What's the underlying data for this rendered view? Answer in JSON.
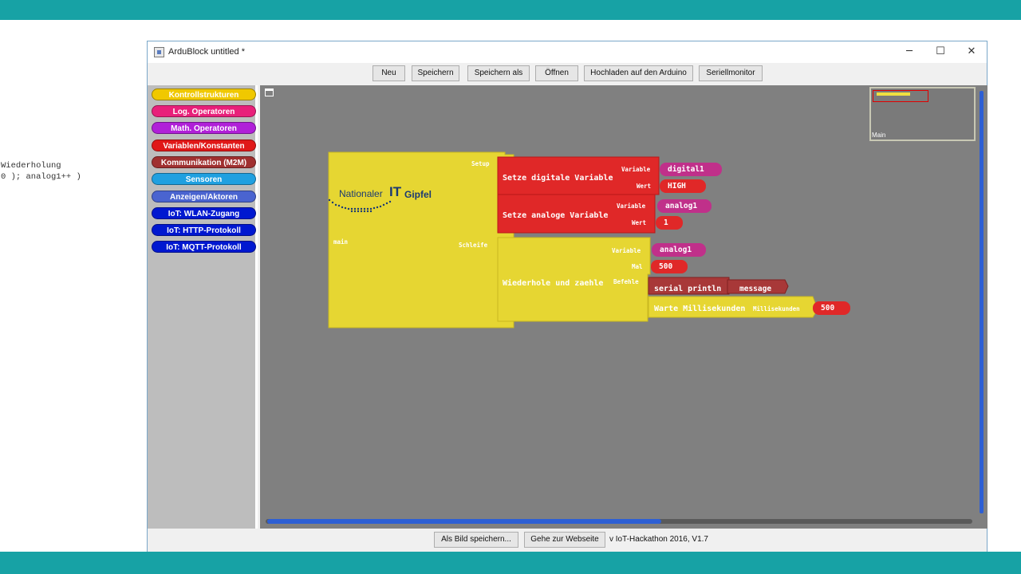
{
  "background_editor": {
    "lines": [
      "Wiederholung",
      "0 ); analog1++ )"
    ]
  },
  "window": {
    "title": "ArduBlock untitled *",
    "controls": {
      "minimize": "─",
      "maximize": "☐",
      "close": "✕"
    }
  },
  "toolbar": {
    "buttons": [
      "Neu",
      "Speichern",
      "Speichern als",
      "Öffnen",
      "Hochladen auf den Arduino",
      "Seriellmonitor"
    ]
  },
  "palette": {
    "categories": [
      {
        "label": "Kontrollstrukturen",
        "color": "#f0c800"
      },
      {
        "label": "Log. Operatoren",
        "color": "#e8207a"
      },
      {
        "label": "Math. Operatoren",
        "color": "#b020d8"
      },
      {
        "label": "Variablen/Konstanten",
        "color": "#e01818"
      },
      {
        "label": "Kommunikation (M2M)",
        "color": "#a03030"
      },
      {
        "label": "Sensoren",
        "color": "#20a0e0"
      },
      {
        "label": "Anzeigen/Aktoren",
        "color": "#4a64d0"
      },
      {
        "label": "IoT: WLAN-Zugang",
        "color": "#0018d0"
      },
      {
        "label": "IoT: HTTP-Protokoll",
        "color": "#0018d0"
      },
      {
        "label": "IoT: MQTT-Protokoll",
        "color": "#0018d0"
      }
    ]
  },
  "minimap": {
    "label": "Main"
  },
  "program": {
    "main": {
      "label": "main",
      "setup_label": "Setup",
      "loop_label": "Schleife"
    },
    "logo": {
      "line1": "Nationaler",
      "line2": "IT",
      "line3": "Gipfel"
    },
    "digital_block": {
      "label": "Setze digitale Variable",
      "var_label": "Variable",
      "val_label": "Wert",
      "var_value": "digital1",
      "val_value": "HIGH"
    },
    "analog_block": {
      "label": "Setze analoge Variable",
      "var_label": "Variable",
      "val_label": "Wert",
      "var_value": "analog1",
      "val_value": "1"
    },
    "repeat_block": {
      "label": "Wiederhole und zaehle",
      "var_label": "Variable",
      "count_label": "Mal",
      "cmd_label": "Befehle",
      "var_value": "analog1",
      "count_value": "500"
    },
    "println_block": {
      "label": "serial println",
      "arg_value": "message"
    },
    "wait_block": {
      "label": "Warte Millisekunden",
      "arg_label": "Millisekunden",
      "arg_value": "500"
    }
  },
  "bottom": {
    "save_image": "Als Bild speichern...",
    "website": "Gehe zur Webseite",
    "version": "v IoT-Hackathon 2016, V1.7"
  },
  "colors": {
    "accent": "#17a2a5",
    "canvas": "#808080",
    "yellow_block": "#e6d632",
    "red_block": "#e02828",
    "magenta_pill": "#c0308a",
    "dark_red_block": "#a83838"
  }
}
